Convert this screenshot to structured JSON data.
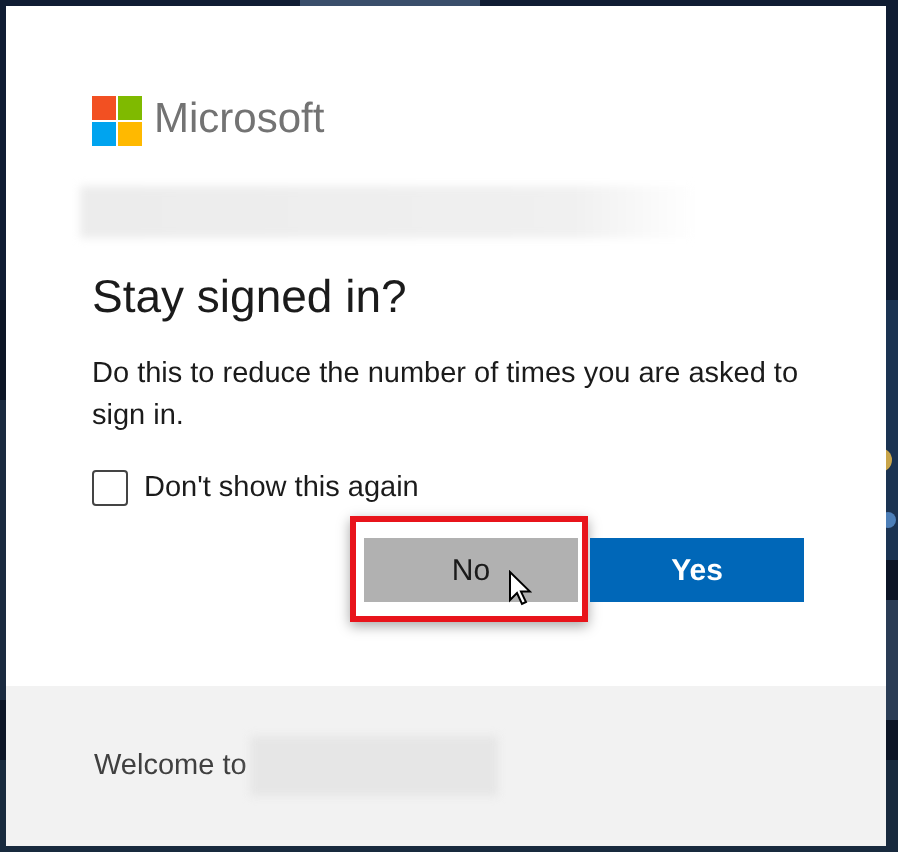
{
  "brand": {
    "name": "Microsoft"
  },
  "title": "Stay signed in?",
  "description": "Do this to reduce the number of times you are asked to sign in.",
  "checkbox": {
    "label": "Don't show this again",
    "checked": false
  },
  "buttons": [
    {
      "label": "No",
      "kind": "secondary",
      "highlighted": true
    },
    {
      "label": "Yes",
      "kind": "primary",
      "highlighted": false
    }
  ],
  "footer": {
    "text": "Welcome to"
  }
}
